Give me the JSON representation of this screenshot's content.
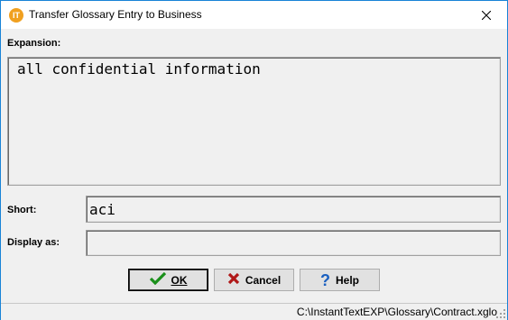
{
  "window": {
    "title": "Transfer Glossary Entry to Business",
    "app_icon_text": "IT"
  },
  "form": {
    "expansion_label": "Expansion:",
    "expansion_value": "all confidential information",
    "short_label": "Short:",
    "short_value": "aci",
    "display_label": "Display as:",
    "display_value": ""
  },
  "buttons": {
    "ok_label": "OK",
    "cancel_label": "Cancel",
    "help_label": "Help"
  },
  "status": {
    "path": "C:\\InstantTextEXP\\Glossary\\Contract.xglo"
  },
  "colors": {
    "ok_check": "#1a8f1a",
    "cancel_x": "#b01818",
    "help_q": "#1a60c0",
    "window_border": "#1883d7"
  }
}
